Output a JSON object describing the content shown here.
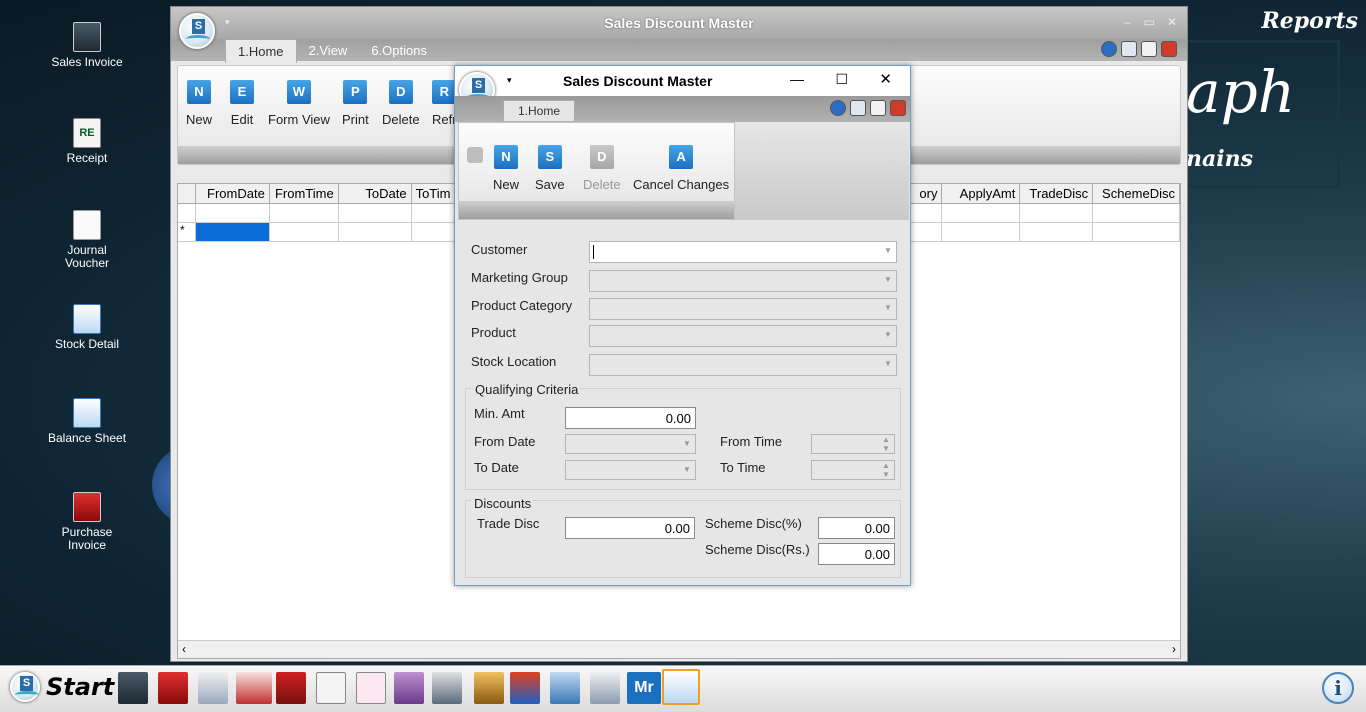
{
  "desktop": {
    "icons": [
      {
        "label": "Sales Invoice"
      },
      {
        "label": "Receipt"
      },
      {
        "label": "Journal Voucher"
      },
      {
        "label": "Stock Detail"
      },
      {
        "label": "Balance Sheet"
      },
      {
        "label": "Purchase Invoice"
      }
    ],
    "reports_label": "Reports",
    "brand_partial_big": "aph",
    "brand_partial_small": "nains"
  },
  "main_window": {
    "title": "Sales Discount Master",
    "tabs": [
      "1.Home",
      "2.View",
      "6.Options"
    ],
    "ribbon_buttons": [
      "New",
      "Edit",
      "Form View",
      "Print",
      "Delete",
      "Refr"
    ],
    "grid_columns": [
      "FromDate",
      "FromTime",
      "ToDate",
      "ToTim",
      "ory",
      "ApplyAmt",
      "TradeDisc",
      "SchemeDisc"
    ],
    "new_row_marker": "*"
  },
  "dialog": {
    "title": "Sales Discount Master",
    "tab": "1.Home",
    "ribbon_buttons": [
      {
        "label": "New",
        "enabled": true
      },
      {
        "label": "Save",
        "enabled": true
      },
      {
        "label": "Delete",
        "enabled": false
      },
      {
        "label": "Cancel Changes",
        "enabled": true
      }
    ],
    "fields": {
      "customer": "Customer",
      "marketing_group": "Marketing Group",
      "product_category": "Product Category",
      "product": "Product",
      "stock_location": "Stock Location"
    },
    "qualifying": {
      "title": "Qualifying Criteria",
      "min_amt_label": "Min. Amt",
      "min_amt_value": "0.00",
      "from_date_label": "From Date",
      "to_date_label": "To Date",
      "from_time_label": "From Time",
      "to_time_label": "To Time"
    },
    "discounts": {
      "title": "Discounts",
      "trade_disc_label": "Trade Disc",
      "trade_disc_value": "0.00",
      "scheme_pct_label": "Scheme Disc(%)",
      "scheme_pct_value": "0.00",
      "scheme_rs_label": "Scheme Disc(Rs.)",
      "scheme_rs_value": "0.00"
    }
  },
  "taskbar": {
    "start_label": "Start"
  },
  "colors": {
    "accent_blue": "#1b6fc0",
    "dialog_border": "#6e9ec8",
    "selected_cell": "#0a6fd8"
  }
}
